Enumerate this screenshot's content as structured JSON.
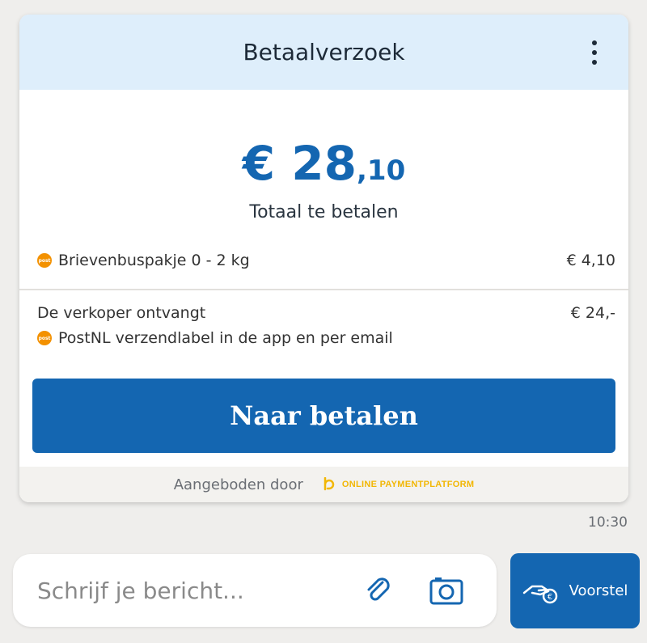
{
  "card": {
    "title": "Betaalverzoek",
    "amount_main": "€ 28",
    "amount_cents": ",10",
    "amount_caption": "Totaal te betalen",
    "shipping": {
      "label": "Brievenbuspakje 0 - 2 kg",
      "price": "€ 4,10"
    },
    "seller": {
      "label": "De verkoper ontvangt",
      "price": "€ 24,-",
      "note": "PostNL verzendlabel in de app en per email"
    },
    "pay_button_label": "Naar betalen",
    "footer_text": "Aangeboden door",
    "provider_name": "ONLINE PAYMENTPLATFORM"
  },
  "timestamp": "10:30",
  "composer": {
    "placeholder": "Schrijf je bericht..."
  },
  "offer_button_label": "Voorstel",
  "colors": {
    "accent": "#1466b1",
    "header_bg": "#deeefb",
    "postnl_orange": "#f39100",
    "opp_yellow": "#f2b705"
  },
  "icons": [
    "kebab-menu-icon",
    "postnl-icon",
    "paperclip-icon",
    "camera-icon",
    "hand-coin-icon",
    "opp-logo"
  ]
}
